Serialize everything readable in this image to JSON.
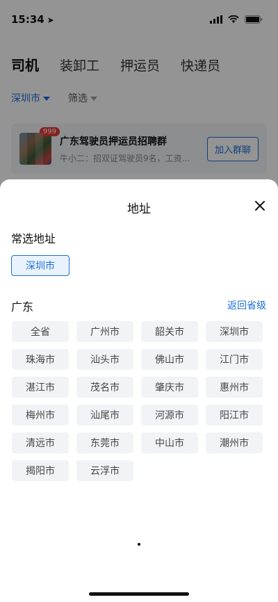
{
  "status_bar": {
    "time": "15:34"
  },
  "tabs": [
    {
      "label": "司机"
    },
    {
      "label": "装卸工"
    },
    {
      "label": "押运员"
    },
    {
      "label": "快递员"
    }
  ],
  "filters": {
    "city": "深圳市",
    "filter": "筛选"
  },
  "group_card": {
    "badge": "999",
    "title": "广东驾驶员押运员招聘群",
    "subtitle": "牛小二：招双证驾驶员9名，工资...",
    "join_label": "加入群聊"
  },
  "sheet": {
    "title": "地址",
    "common_label": "常选地址",
    "common_selected": "深圳市",
    "province_label": "广东",
    "back_label": "返回省级",
    "cities": [
      "全省",
      "广州市",
      "韶关市",
      "深圳市",
      "珠海市",
      "汕头市",
      "佛山市",
      "江门市",
      "湛江市",
      "茂名市",
      "肇庆市",
      "惠州市",
      "梅州市",
      "汕尾市",
      "河源市",
      "阳江市",
      "清远市",
      "东莞市",
      "中山市",
      "潮州市",
      "揭阳市",
      "云浮市"
    ]
  },
  "colors": {
    "accent": "#1a6fd6",
    "chip_bg": "#f1f3f6",
    "overlay": "rgba(0,0,0,0.42)"
  },
  "icons": [
    "location-arrow-icon",
    "signal-icon",
    "wifi-icon",
    "battery-icon",
    "close-icon"
  ]
}
